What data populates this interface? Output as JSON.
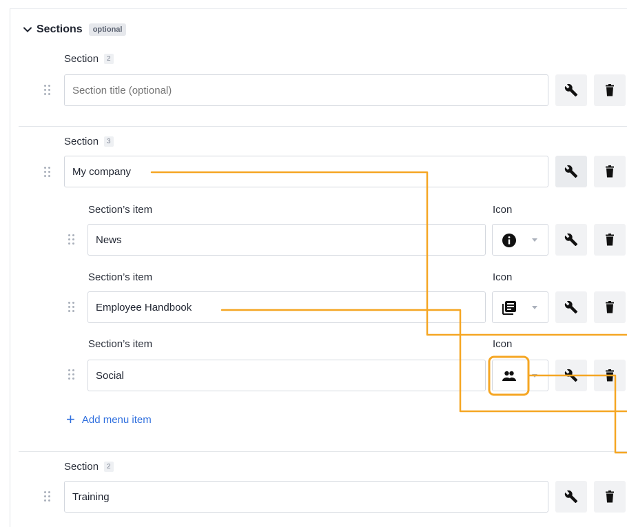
{
  "sections_header": {
    "title": "Sections",
    "badge": "optional"
  },
  "sections": [
    {
      "label": "Section",
      "count": "2",
      "value": "",
      "placeholder": "Section title (optional)"
    },
    {
      "label": "Section",
      "count": "3",
      "value": "My company",
      "items": [
        {
          "label": "Section’s item",
          "icon_label": "Icon",
          "value": "News",
          "icon": "info-icon"
        },
        {
          "label": "Section’s item",
          "icon_label": "Icon",
          "value": "Employee Handbook",
          "icon": "library-books-icon"
        },
        {
          "label": "Section’s item",
          "icon_label": "Icon",
          "value": "Social",
          "icon": "people-icon"
        }
      ],
      "add_item_label": "Add menu item"
    },
    {
      "label": "Section",
      "count": "2",
      "value": "Training"
    }
  ],
  "colors": {
    "accent": "#2f6fde",
    "annotation": "#f5a623",
    "border": "#d3d7de",
    "button_bg": "#f1f2f4"
  },
  "actions": {
    "settings_icon": "wrench-icon",
    "delete_icon": "trash-icon"
  }
}
